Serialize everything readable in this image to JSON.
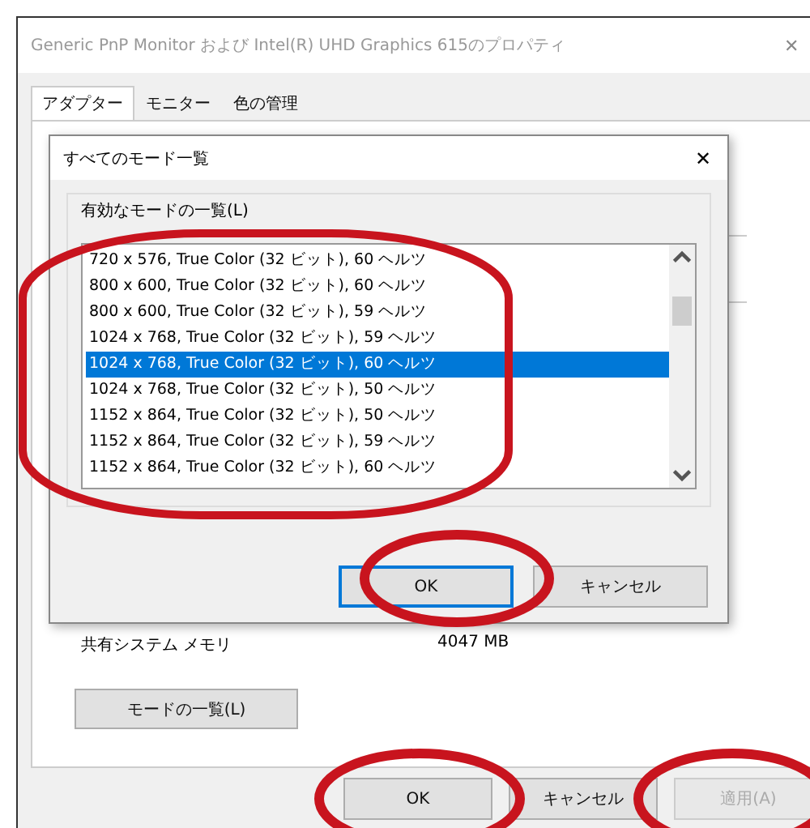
{
  "window": {
    "title": "Generic PnP Monitor および Intel(R) UHD Graphics 615のプロパティ",
    "close": "✕"
  },
  "tabs": [
    {
      "label": "アダプター",
      "selected": true
    },
    {
      "label": "モニター",
      "selected": false
    },
    {
      "label": "色の管理",
      "selected": false
    }
  ],
  "adapter_panel": {
    "memory_label": "共有システム メモリ",
    "memory_value": "4047 MB",
    "list_modes_button": "モードの一覧(L)"
  },
  "buttons": [
    {
      "label": "OK",
      "disabled": false
    },
    {
      "label": "キャンセル",
      "disabled": false
    },
    {
      "label": "適用(A)",
      "disabled": true
    }
  ],
  "mode_dialog": {
    "title": "すべてのモード一覧",
    "close": "✕",
    "list_label": "有効なモードの一覧(L)",
    "modes": [
      {
        "label": "720 x 576, True Color (32 ビット), 60 ヘルツ",
        "selected": false
      },
      {
        "label": "800 x 600, True Color (32 ビット), 60 ヘルツ",
        "selected": false
      },
      {
        "label": "800 x 600, True Color (32 ビット), 59 ヘルツ",
        "selected": false
      },
      {
        "label": "1024 x 768, True Color (32 ビット), 59 ヘルツ",
        "selected": false
      },
      {
        "label": "1024 x 768, True Color (32 ビット), 60 ヘルツ",
        "selected": true
      },
      {
        "label": "1024 x 768, True Color (32 ビット), 50 ヘルツ",
        "selected": false
      },
      {
        "label": "1152 x 864, True Color (32 ビット), 50 ヘルツ",
        "selected": false
      },
      {
        "label": "1152 x 864, True Color (32 ビット), 59 ヘルツ",
        "selected": false
      },
      {
        "label": "1152 x 864, True Color (32 ビット), 60 ヘルツ",
        "selected": false
      }
    ],
    "buttons": [
      {
        "label": "OK",
        "default": true
      },
      {
        "label": "キャンセル",
        "default": false
      }
    ]
  }
}
